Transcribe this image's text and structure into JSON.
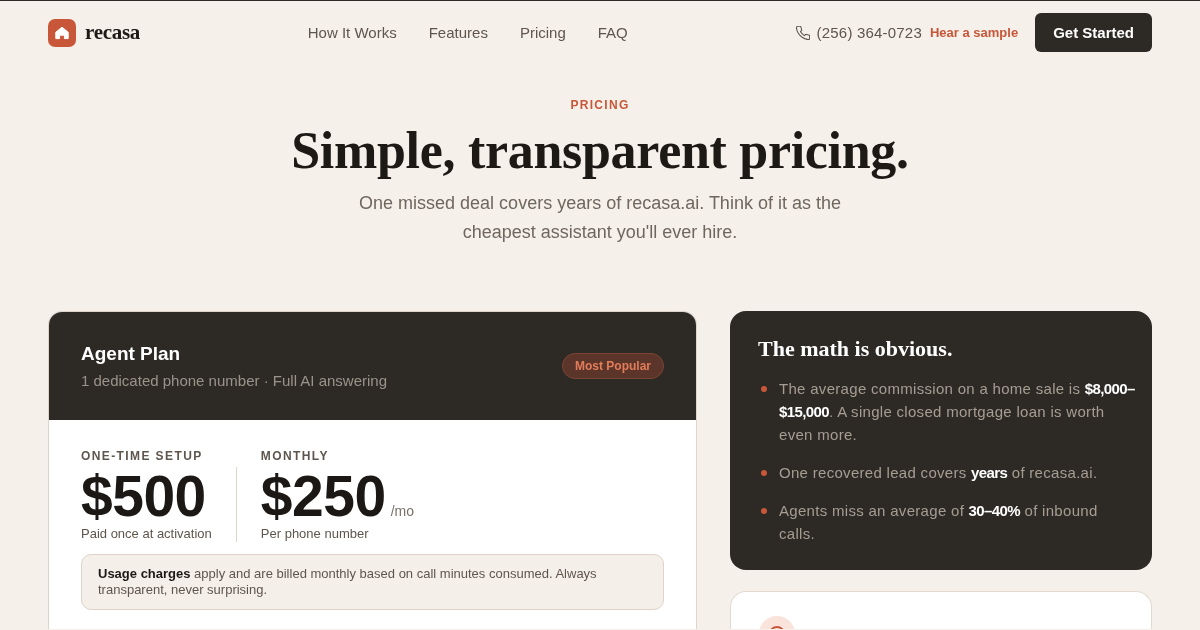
{
  "header": {
    "logo": "recasa",
    "nav": [
      "How It Works",
      "Features",
      "Pricing",
      "FAQ"
    ],
    "phone": "(256) 364-0723",
    "sample_link": "Hear a sample",
    "cta": "Get Started"
  },
  "hero": {
    "eyebrow": "PRICING",
    "title": "Simple, transparent pricing.",
    "subtitle": "One missed deal covers years of recasa.ai. Think of it as the cheapest assistant you'll ever hire."
  },
  "plan": {
    "name": "Agent Plan",
    "description": "1 dedicated phone number · Full AI answering",
    "badge": "Most Popular",
    "prices": [
      {
        "label": "ONE-TIME SETUP",
        "amount": "$500",
        "note": "Paid once at activation"
      },
      {
        "label": "MONTHLY",
        "amount": "$250",
        "unit": "/mo",
        "note": "Per phone number"
      }
    ],
    "usage_note": "**Usage charges** apply and are billed monthly based on call minutes consumed. Always transparent, never surprising."
  },
  "math": {
    "title": "The math is obvious.",
    "points": [
      "The average commission on a home sale is **$8,000–$15,000**. A single closed mortgage loan is worth even more.",
      "One recovered lead covers **years** of recasa.ai.",
      "Agents miss an average of **30–40%** of inbound calls."
    ]
  }
}
